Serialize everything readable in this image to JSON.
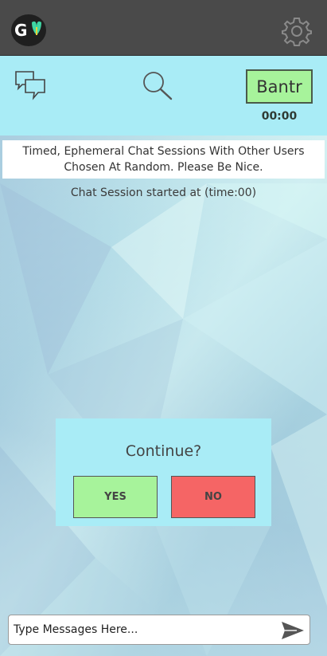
{
  "header": {
    "logo_letter": "G",
    "settings_icon": "gear-icon"
  },
  "nav": {
    "chat_icon": "chat-bubbles-icon",
    "search_icon": "search-icon",
    "bantr_label": "Bantr",
    "timer": "00:00"
  },
  "description": {
    "line1": "Timed, Ephemeral Chat Sessions With Other Users",
    "line2": "Chosen At Random. Please Be Nice."
  },
  "session_text": "Chat Session started at (time:00)",
  "dialog": {
    "title": "Continue?",
    "yes_label": "YES",
    "no_label": "NO"
  },
  "composer": {
    "placeholder": "Type Messages Here...",
    "send_icon": "send-icon"
  },
  "colors": {
    "topbar": "#4a4a4a",
    "navbar": "#a9ecf6",
    "yes": "#a7f39b",
    "no": "#f56565"
  }
}
